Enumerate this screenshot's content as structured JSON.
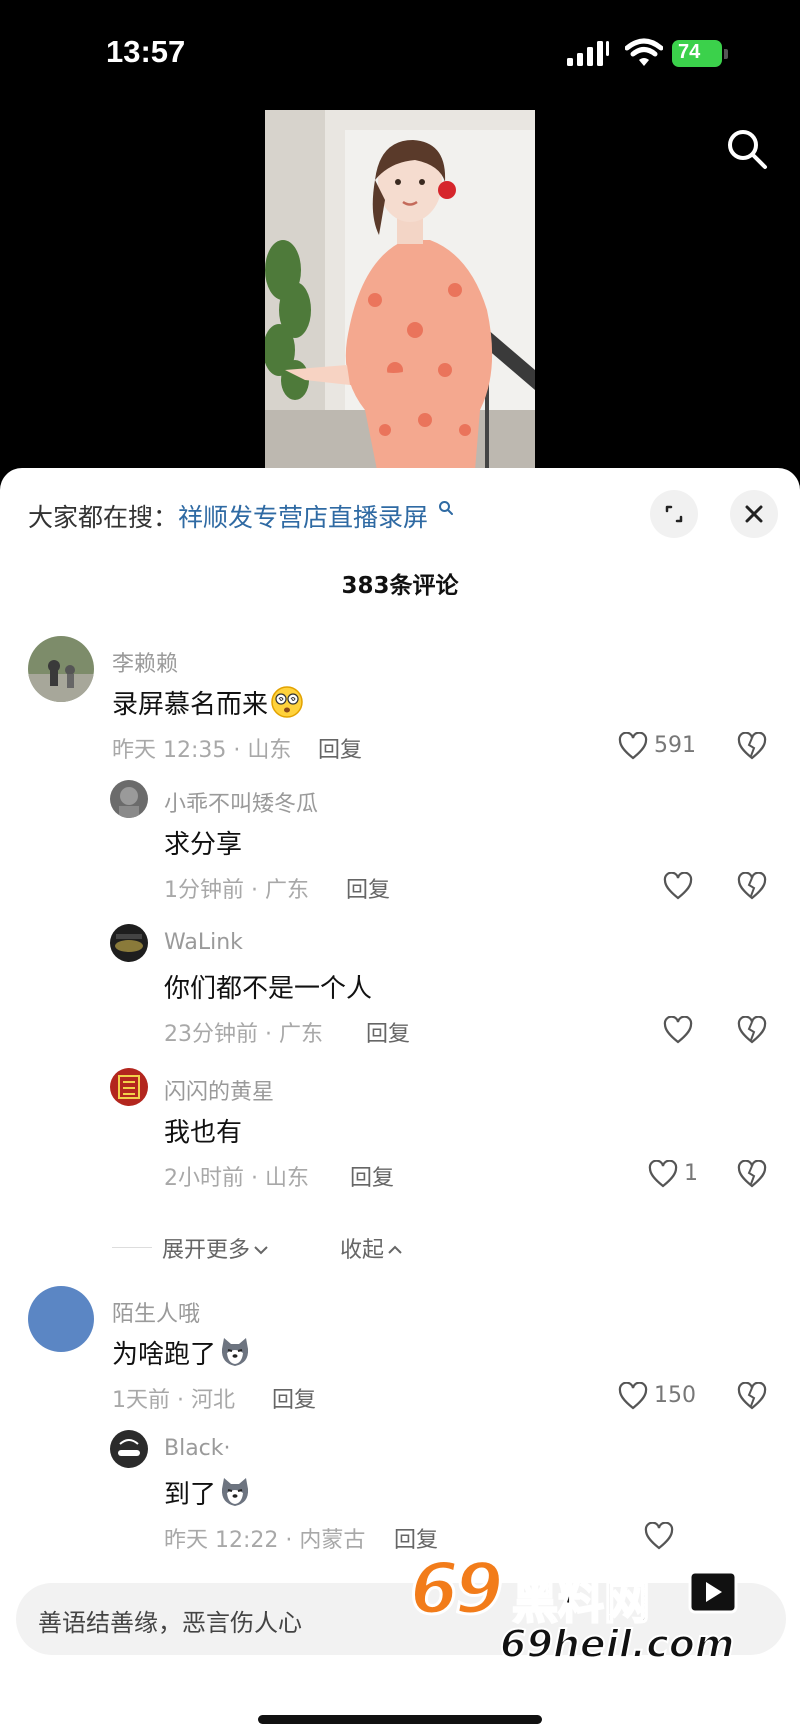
{
  "status_bar": {
    "time": "13:57",
    "battery": "74"
  },
  "hot_search": {
    "prefix": "大家都在搜：",
    "query": "祥顺发专营店直播录屏"
  },
  "comment_count": "383条评论",
  "comments": [
    {
      "user": "李赖赖",
      "text": "录屏慕名而来",
      "emoji": "dizzy-face-emoji",
      "time_loc": "昨天 12:35 · 山东",
      "reply": "回复",
      "likes": "591",
      "avatar_color": "#6d7a5e"
    },
    {
      "user": "小乖不叫矮冬瓜",
      "text": "求分享",
      "time_loc": "1分钟前 · 广东",
      "reply": "回复",
      "likes": "",
      "avatar_color": "#5a5a5a"
    },
    {
      "user": "WaLink",
      "text": "你们都不是一个人",
      "time_loc": "23分钟前 · 广东",
      "reply": "回复",
      "likes": "",
      "avatar_color": "#2a2a2a"
    },
    {
      "user": "闪闪的黄星",
      "text": "我也有",
      "time_loc": "2小时前 · 山东",
      "reply": "回复",
      "likes": "1",
      "avatar_color": "#b3261e"
    },
    {
      "user": "陌生人哦",
      "text": "为啥跑了",
      "emoji": "husky-emoji",
      "time_loc": "1天前 · 河北",
      "reply": "回复",
      "likes": "150",
      "avatar_color": "#5b86c4"
    },
    {
      "user": "Black·",
      "text": "到了",
      "emoji": "husky-emoji",
      "time_loc": "昨天 12:22 · 内蒙古",
      "reply": "回复",
      "likes": "",
      "avatar_color": "#3a3a3a"
    }
  ],
  "expand_more": "展开更多",
  "collapse": "收起",
  "input_placeholder": "善语结善缘，恶言伤人心",
  "watermark": {
    "line1": "69",
    "line2": "黑料网",
    "line3": "69heil.com"
  }
}
